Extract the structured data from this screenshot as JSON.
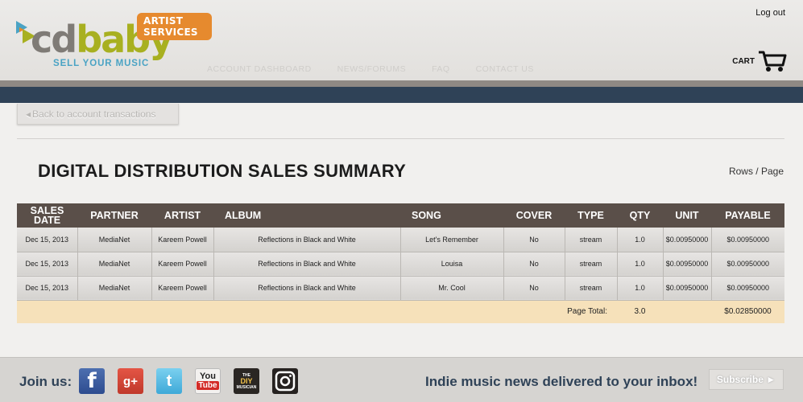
{
  "header": {
    "logo": {
      "wordmark_cd": "cd",
      "wordmark_baby": "baby",
      "badge": "ARTIST SERVICES",
      "tagline": "SELL YOUR MUSIC",
      "trademark": "™"
    },
    "logout": "Log out",
    "cart_label": "CART",
    "nav": [
      "ACCOUNT DASHBOARD",
      "NEWS/FORUMS",
      "FAQ",
      "CONTACT US"
    ]
  },
  "back_button": "Back to account transactions",
  "page_title": "DIGITAL DISTRIBUTION SALES SUMMARY",
  "rows_per_page": "Rows / Page",
  "table": {
    "headers": [
      "SALES DATE",
      "PARTNER",
      "ARTIST",
      "ALBUM",
      "SONG",
      "COVER",
      "TYPE",
      "QTY",
      "UNIT",
      "PAYABLE"
    ],
    "rows": [
      [
        "Dec 15, 2013",
        "MediaNet",
        "Kareem Powell",
        "Reflections in Black and White",
        "Let's Remember",
        "No",
        "stream",
        "1.0",
        "$0.00950000",
        "$0.00950000"
      ],
      [
        "Dec 15, 2013",
        "MediaNet",
        "Kareem Powell",
        "Reflections in Black and White",
        "Louisa",
        "No",
        "stream",
        "1.0",
        "$0.00950000",
        "$0.00950000"
      ],
      [
        "Dec 15, 2013",
        "MediaNet",
        "Kareem Powell",
        "Reflections in Black and White",
        "Mr. Cool",
        "No",
        "stream",
        "1.0",
        "$0.00950000",
        "$0.00950000"
      ]
    ],
    "total": {
      "label": "Page Total:",
      "qty": "3.0",
      "payable": "$0.02850000"
    }
  },
  "footer": {
    "join": "Join us:",
    "social": [
      {
        "icon": "facebook-icon",
        "glyph": "f"
      },
      {
        "icon": "google-plus-icon",
        "glyph": "g+"
      },
      {
        "icon": "twitter-icon",
        "glyph": "t"
      },
      {
        "icon": "youtube-icon",
        "glyph_top": "You",
        "glyph_bottom": "Tube"
      },
      {
        "icon": "diy-musician-icon",
        "glyph_top": "THE",
        "glyph_mid": "DIY",
        "glyph_bottom": "MUSICIAN"
      },
      {
        "icon": "instagram-icon"
      }
    ],
    "newsletter": "Indie music news delivered to your inbox!",
    "subscribe": "Subscribe ►"
  },
  "colors": {
    "accent_orange": "#e68a2e",
    "brand_green": "#a8b020",
    "navy": "#2f4257",
    "table_header": "#5a4f49",
    "total_row": "#f6e1ba"
  }
}
